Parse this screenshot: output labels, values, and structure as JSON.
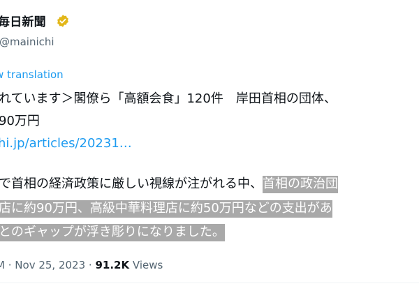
{
  "author": {
    "name": "毎日新聞",
    "handle": "@mainichi",
    "verified_color": "#e2b719"
  },
  "tweet": {
    "show_translation": "w translation",
    "line1": "れています＞閣僚ら「高額会食」120件　岸田首相の団体、",
    "line2": "90万円",
    "link": "hi.jp/articles/20231…",
    "line4_plain": "で首相の経済政策に厳しい視線が注がれる中、",
    "line4_highlight": "首相の政治団",
    "line5_highlight": "店に約90万円、高級中華料理店に約50万円などの支出があ",
    "line6_highlight": "とのギャップが浮き彫りになりました。",
    "highlight_color": "#a9a9a9"
  },
  "meta": {
    "time_fragment": "M",
    "separator": "·",
    "date": "Nov 25, 2023",
    "views_count": "91.2K",
    "views_label": "Views"
  }
}
